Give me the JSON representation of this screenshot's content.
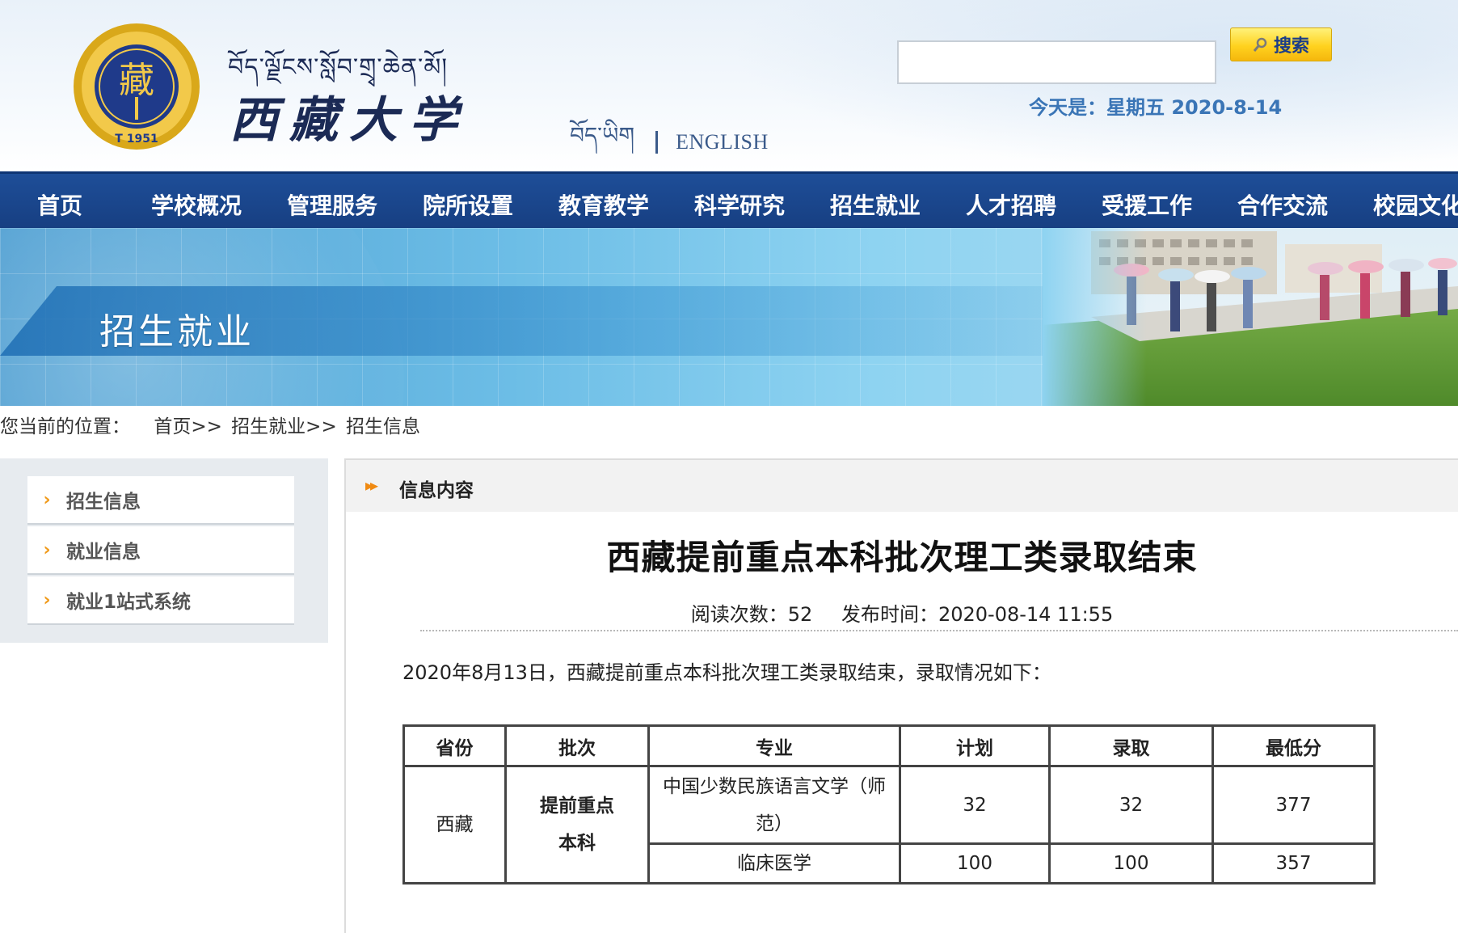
{
  "header": {
    "tibetan_name": "བོད་ལྗོངས་སློབ་གྲྭ་ཆེན་མོ།",
    "seal_char": "藏",
    "seal_year": "T 1951",
    "site_title": "西藏大学",
    "lang_tibetan": "བོད་ཡིག",
    "lang_english": "ENGLISH",
    "search_placeholder": "",
    "search_button": "搜索",
    "today_label": "今天是：星期五 2020-8-14"
  },
  "nav": {
    "items": [
      {
        "label": "首页"
      },
      {
        "label": "学校概况"
      },
      {
        "label": "管理服务"
      },
      {
        "label": "院所设置"
      },
      {
        "label": "教育教学"
      },
      {
        "label": "科学研究"
      },
      {
        "label": "招生就业"
      },
      {
        "label": "人才招聘"
      },
      {
        "label": "受援工作"
      },
      {
        "label": "合作交流"
      },
      {
        "label": "校园文化"
      }
    ]
  },
  "banner": {
    "title": "招生就业"
  },
  "breadcrumb": {
    "prefix": "您当前的位置：",
    "items": [
      "首页>>",
      "招生就业>>",
      "招生信息"
    ]
  },
  "sidebar": {
    "items": [
      {
        "label": "招生信息"
      },
      {
        "label": "就业信息"
      },
      {
        "label": "就业1站式系统"
      }
    ]
  },
  "content": {
    "section_title": "信息内容",
    "article_title": "西藏提前重点本科批次理工类录取结束",
    "reads_label": "阅读次数：52",
    "publish_label": "发布时间：2020-08-14 11:55",
    "intro": "2020年8月13日，西藏提前重点本科批次理工类录取结束，录取情况如下："
  },
  "table": {
    "headers": [
      "省份",
      "批次",
      "专业",
      "计划",
      "录取",
      "最低分"
    ],
    "province": "西藏",
    "batch_line1": "提前重点",
    "batch_line2": "本科",
    "rows": [
      {
        "major_line1": "中国少数民族语言文学（师",
        "major_line2": "范）",
        "plan": "32",
        "admitted": "32",
        "min_score": "377"
      },
      {
        "major_line1": "临床医学",
        "major_line2": "",
        "plan": "100",
        "admitted": "100",
        "min_score": "357"
      }
    ]
  },
  "colors": {
    "nav_blue": "#1e4e98",
    "accent_orange": "#f09a1a",
    "date_blue": "#3a75b6",
    "search_yellow": "#ffd21f"
  },
  "icons": {
    "search": "magnifier-icon",
    "sidebar_bullet": "chevron-right-icon",
    "section_bullet": "double-arrow-right-icon"
  }
}
